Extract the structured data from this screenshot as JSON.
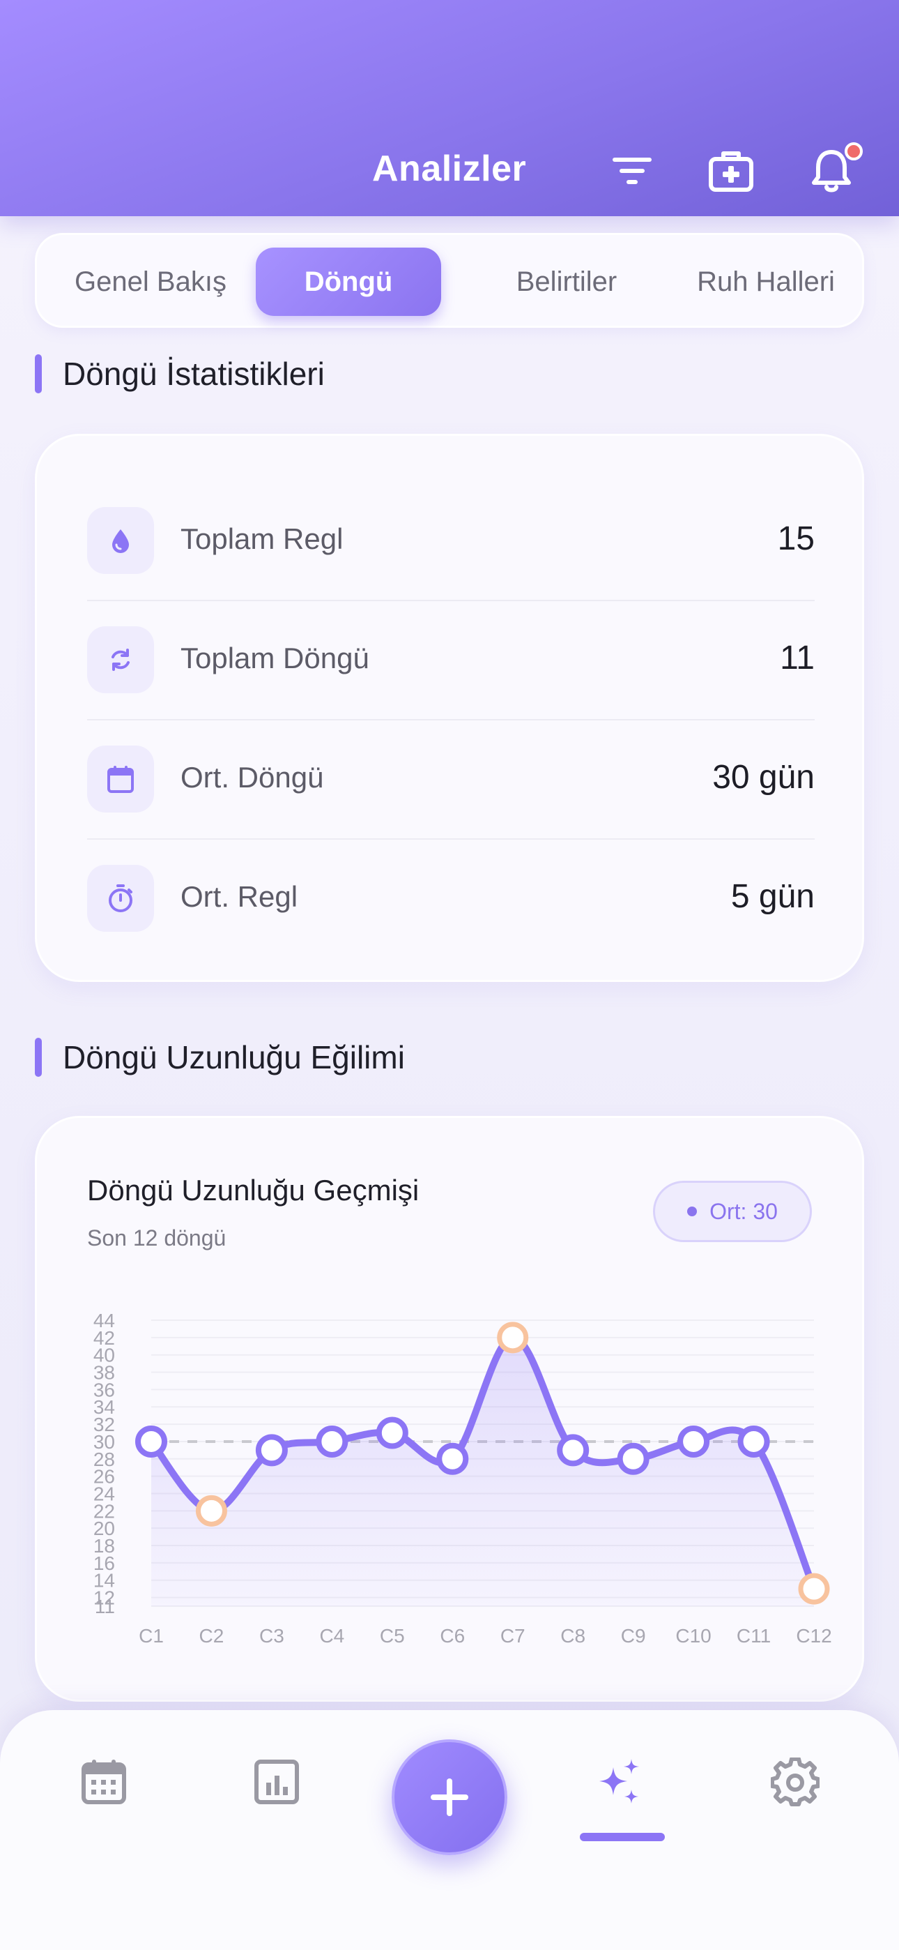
{
  "header": {
    "title": "Analizler",
    "icons": [
      "filter-icon",
      "medical-kit-icon",
      "bell-icon"
    ],
    "has_notification": true
  },
  "tabs": [
    {
      "label": "Genel Bakış",
      "active": false
    },
    {
      "label": "Döngü",
      "active": true
    },
    {
      "label": "Belirtiler",
      "active": false
    },
    {
      "label": "Ruh Halleri",
      "active": false
    }
  ],
  "stats_section": {
    "title": "Döngü İstatistikleri",
    "rows": [
      {
        "icon": "drop-icon",
        "label": "Toplam Regl",
        "value": "15"
      },
      {
        "icon": "refresh-icon",
        "label": "Toplam Döngü",
        "value": "11"
      },
      {
        "icon": "calendar-icon",
        "label": "Ort. Döngü",
        "value": "30 gün"
      },
      {
        "icon": "timer-icon",
        "label": "Ort. Regl",
        "value": "5 gün"
      }
    ]
  },
  "trend_section": {
    "title": "Döngü Uzunluğu Eğilimi",
    "card_title": "Döngü Uzunluğu Geçmişi",
    "card_subtitle": "Son 12 döngü",
    "avg_badge": "Ort: 30"
  },
  "chart_data": {
    "type": "line",
    "categories": [
      "C1",
      "C2",
      "C3",
      "C4",
      "C5",
      "C6",
      "C7",
      "C8",
      "C9",
      "C10",
      "C11",
      "C12"
    ],
    "series": [
      {
        "values": [
          30,
          22,
          29,
          30,
          31,
          28,
          42,
          29,
          28,
          30,
          30,
          13
        ]
      }
    ],
    "outliers": [
      "C2",
      "C7",
      "C12"
    ],
    "average": 30,
    "ylim": [
      11,
      44
    ],
    "yticks": [
      44,
      42,
      40,
      38,
      36,
      34,
      32,
      30,
      28,
      26,
      24,
      22,
      20,
      18,
      16,
      14,
      12,
      11
    ],
    "colors": {
      "line": "#8c75f5",
      "outlier": "#f8c39e",
      "average": "#c9c9cf"
    }
  },
  "bottom_nav": {
    "items": [
      "calendar-icon",
      "stats-icon",
      "add-button",
      "sparkle-icon",
      "gear-icon"
    ],
    "active": "sparkle-icon"
  },
  "colors": {
    "accent": "#8c75f5",
    "header": "#8a76ec"
  }
}
